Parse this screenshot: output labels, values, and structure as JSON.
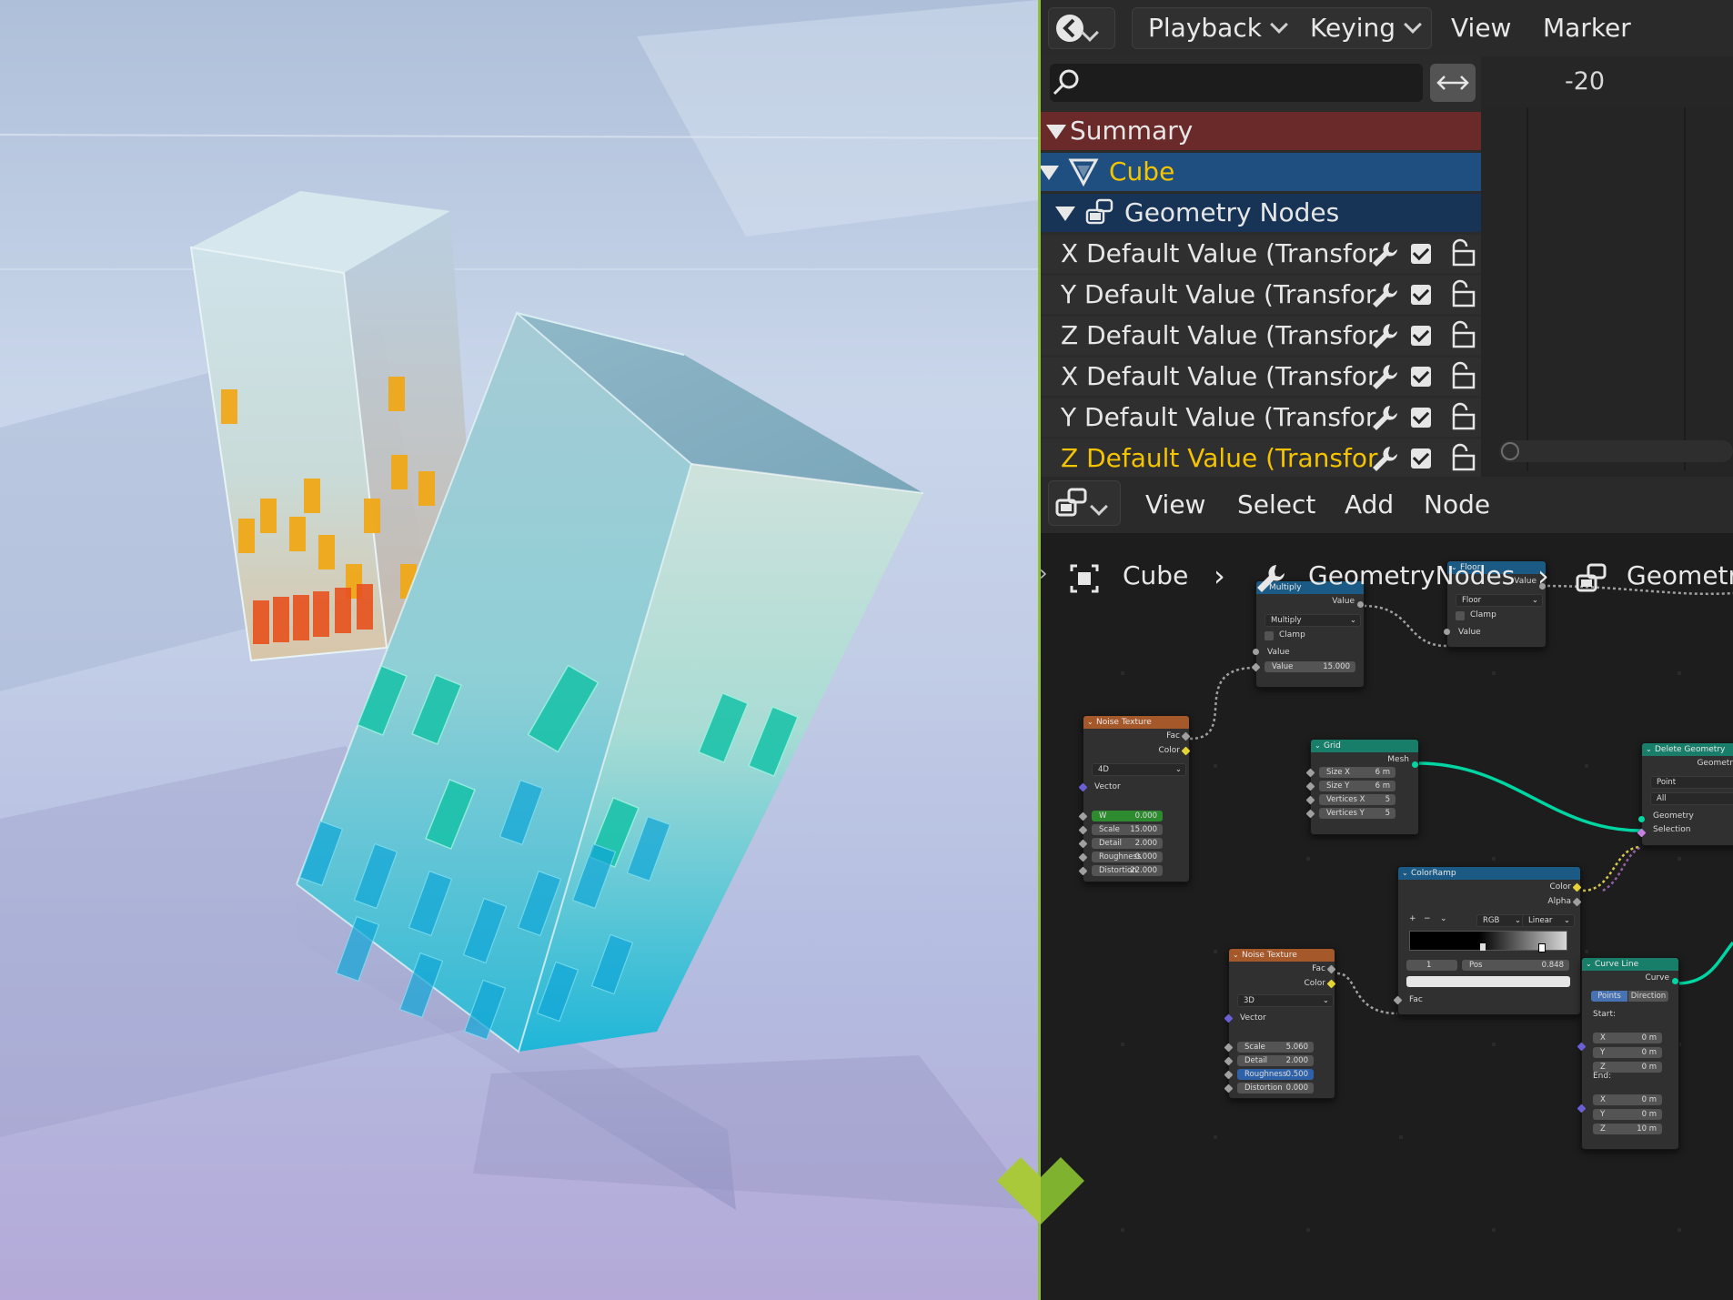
{
  "timeline": {
    "menu": [
      "Playback",
      "Keying",
      "View",
      "Marker"
    ],
    "search_placeholder": "",
    "frame_label": "-20",
    "summary_label": "Summary",
    "object_label": "Cube",
    "modifier_label": "Geometry Nodes",
    "channels": [
      {
        "label": "X Default Value (Transfor",
        "highlight": false
      },
      {
        "label": "Y Default Value (Transfor",
        "highlight": false
      },
      {
        "label": "Z Default Value (Transfor",
        "highlight": false
      },
      {
        "label": "X Default Value (Transfor",
        "highlight": false
      },
      {
        "label": "Y Default Value (Transfor",
        "highlight": false
      },
      {
        "label": "Z Default Value (Transfor",
        "highlight": true
      }
    ]
  },
  "node_editor": {
    "menu": [
      "View",
      "Select",
      "Add",
      "Node"
    ],
    "breadcrumb": [
      "Cube",
      "GeometryNodes",
      "Geometr"
    ],
    "nodes": {
      "multiply": {
        "title": "Multiply",
        "out_value": "Value",
        "op": "Multiply",
        "clamp": "Clamp",
        "in_value": "Value",
        "value_field": "Value",
        "value_num": "15.000"
      },
      "floor": {
        "title": "Floor",
        "out_value": "Value",
        "op": "Floor",
        "clamp": "Clamp",
        "in_value": "Value"
      },
      "noise1": {
        "title": "Noise Texture",
        "fac": "Fac",
        "color": "Color",
        "dim": "4D",
        "vector": "Vector",
        "fields": [
          {
            "k": "W",
            "v": "0.000"
          },
          {
            "k": "Scale",
            "v": "15.000"
          },
          {
            "k": "Detail",
            "v": "2.000"
          },
          {
            "k": "Roughness",
            "v": "0.000"
          },
          {
            "k": "Distortion",
            "v": "22.000"
          }
        ]
      },
      "grid": {
        "title": "Grid",
        "mesh": "Mesh",
        "fields": [
          {
            "k": "Size X",
            "v": "6 m"
          },
          {
            "k": "Size Y",
            "v": "6 m"
          },
          {
            "k": "Vertices X",
            "v": "5"
          },
          {
            "k": "Vertices Y",
            "v": "5"
          }
        ]
      },
      "delete": {
        "title": "Delete Geometry",
        "geom_out": "Geometr",
        "domain": "Point",
        "mode": "All",
        "geometry": "Geometry",
        "selection": "Selection"
      },
      "colorramp": {
        "title": "ColorRamp",
        "color": "Color",
        "alpha": "Alpha",
        "btns": [
          "+",
          "−"
        ],
        "mode": "RGB",
        "interp": "Linear",
        "index": "1",
        "pos_label": "Pos",
        "pos_value": "0.848",
        "fac": "Fac"
      },
      "noise2": {
        "title": "Noise Texture",
        "fac": "Fac",
        "color": "Color",
        "dim": "3D",
        "vector": "Vector",
        "fields": [
          {
            "k": "Scale",
            "v": "5.060"
          },
          {
            "k": "Detail",
            "v": "2.000"
          },
          {
            "k": "Roughness",
            "v": "0.500"
          },
          {
            "k": "Distortion",
            "v": "0.000"
          }
        ]
      },
      "curveline": {
        "title": "Curve Line",
        "curve": "Curve",
        "mode_a": "Points",
        "mode_b": "Direction",
        "start": "Start:",
        "end": "End:",
        "start_fields": [
          {
            "k": "X",
            "v": "0 m"
          },
          {
            "k": "Y",
            "v": "0 m"
          },
          {
            "k": "Z",
            "v": "0 m"
          }
        ],
        "end_fields": [
          {
            "k": "X",
            "v": "0 m"
          },
          {
            "k": "Y",
            "v": "0 m"
          },
          {
            "k": "Z",
            "v": "10 m"
          }
        ]
      }
    }
  },
  "colors": {
    "accent_green": "#8fbf3c",
    "summary_row": "#6b2a2a",
    "object_row": "#1e4f80",
    "modifier_row": "#173456",
    "highlight_text": "#f5c400",
    "geometry_socket": "#00d6a3"
  }
}
